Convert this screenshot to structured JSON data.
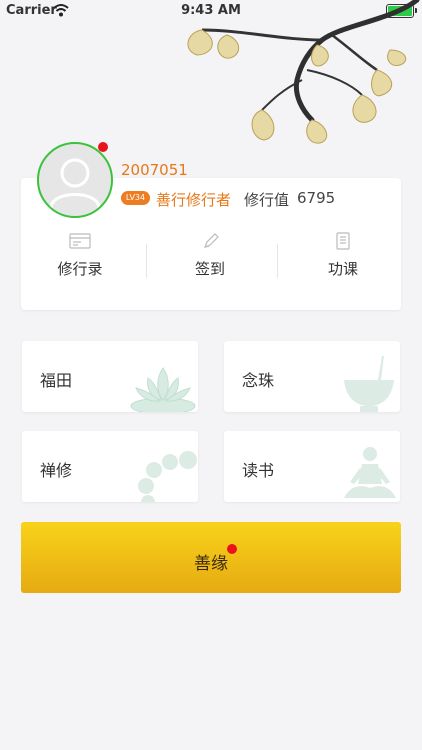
{
  "status_bar": {
    "carrier": "Carrier",
    "time": "9:43 AM",
    "battery_color": "#2bcc4a"
  },
  "profile": {
    "user_id": "2007051",
    "level": "LV34",
    "title": "善行修行者",
    "practice_label": "修行值",
    "practice_value": "6795",
    "accent_color": "#e77818",
    "notification": true
  },
  "actions": [
    {
      "label": "修行录",
      "icon": "record-card-icon"
    },
    {
      "label": "签到",
      "icon": "pencil-icon"
    },
    {
      "label": "功课",
      "icon": "book-icon"
    }
  ],
  "tiles": [
    {
      "label": "福田",
      "icon": "lotus-icon"
    },
    {
      "label": "念珠",
      "icon": "incense-bowl-icon"
    },
    {
      "label": "禅修",
      "icon": "prayer-beads-icon"
    },
    {
      "label": "读书",
      "icon": "meditation-figure-icon"
    }
  ],
  "yuan_button": {
    "label": "善缘",
    "notification": true,
    "gradient": [
      "#f8d31a",
      "#e6aa12"
    ]
  }
}
